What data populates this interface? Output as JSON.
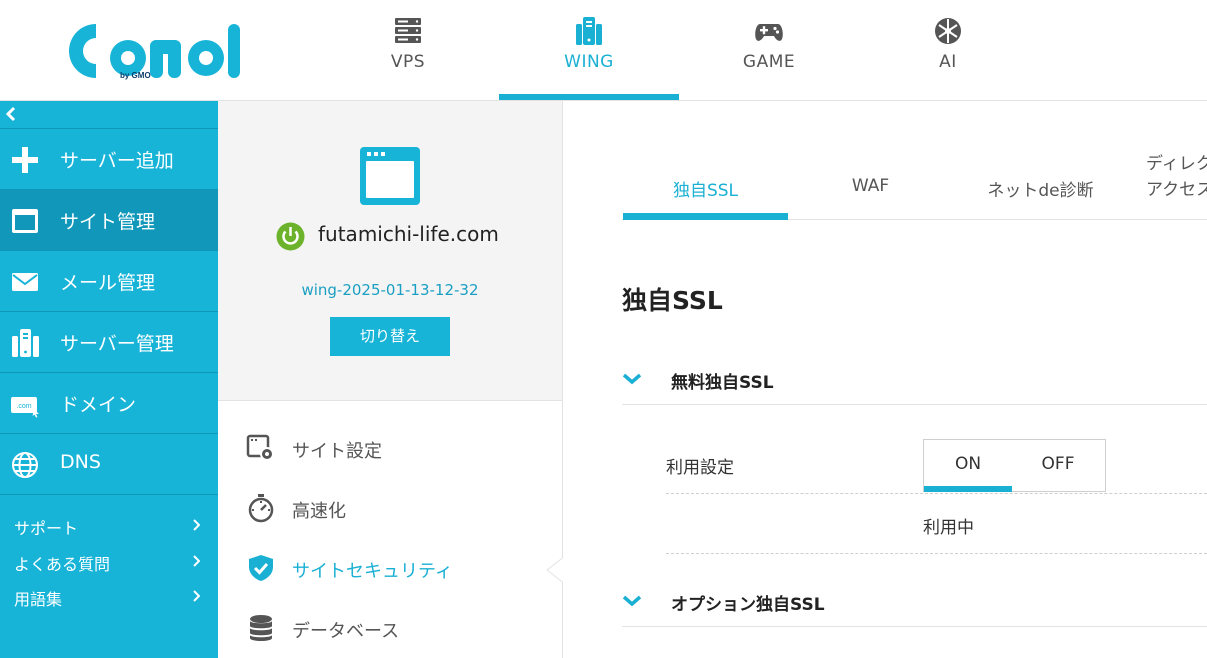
{
  "brand": {
    "logo_text": "ConoHa",
    "sub_text": "by GMO",
    "accent": "#17b4d8",
    "accent_dark": "#1097b9"
  },
  "top_nav": [
    {
      "label": "VPS",
      "icon": "server-stack-icon"
    },
    {
      "label": "WING",
      "icon": "wing-server-icon",
      "active": true
    },
    {
      "label": "GAME",
      "icon": "gamepad-icon"
    },
    {
      "label": "AI",
      "icon": "ai-chip-icon"
    }
  ],
  "sidebar": {
    "items": [
      {
        "label": "サーバー追加",
        "icon": "plus-icon"
      },
      {
        "label": "サイト管理",
        "icon": "browser-window-icon",
        "active": true
      },
      {
        "label": "メール管理",
        "icon": "mail-icon"
      },
      {
        "label": "サーバー管理",
        "icon": "server-icon"
      },
      {
        "label": "ドメイン",
        "icon": "domain-icon",
        "icon_text": ".com"
      },
      {
        "label": "DNS",
        "icon": "globe-icon"
      }
    ],
    "links": [
      {
        "label": "サポート"
      },
      {
        "label": "よくある質問"
      },
      {
        "label": "用語集"
      }
    ]
  },
  "site_panel": {
    "domain": "futamichi-life.com",
    "plan_name": "wing-2025-01-13-12-32",
    "switch_label": "切り替え",
    "menu": [
      {
        "label": "サイト設定",
        "icon": "site-settings-icon"
      },
      {
        "label": "高速化",
        "icon": "stopwatch-icon"
      },
      {
        "label": "サイトセキュリティ",
        "icon": "shield-check-icon",
        "active": true
      },
      {
        "label": "データベース",
        "icon": "database-icon"
      }
    ]
  },
  "tabs": [
    {
      "label": "独自SSL",
      "active": true
    },
    {
      "label": "WAF"
    },
    {
      "label": "ネットde診断"
    },
    {
      "line1": "ディレク",
      "line2": "アクセス"
    }
  ],
  "content": {
    "title": "独自SSL",
    "sections": [
      {
        "label": "無料独自SSL"
      },
      {
        "label": "オプション独自SSL"
      }
    ],
    "setting_label": "利用設定",
    "toggle": {
      "on": "ON",
      "off": "OFF",
      "selected": "ON"
    },
    "status": "利用中"
  }
}
